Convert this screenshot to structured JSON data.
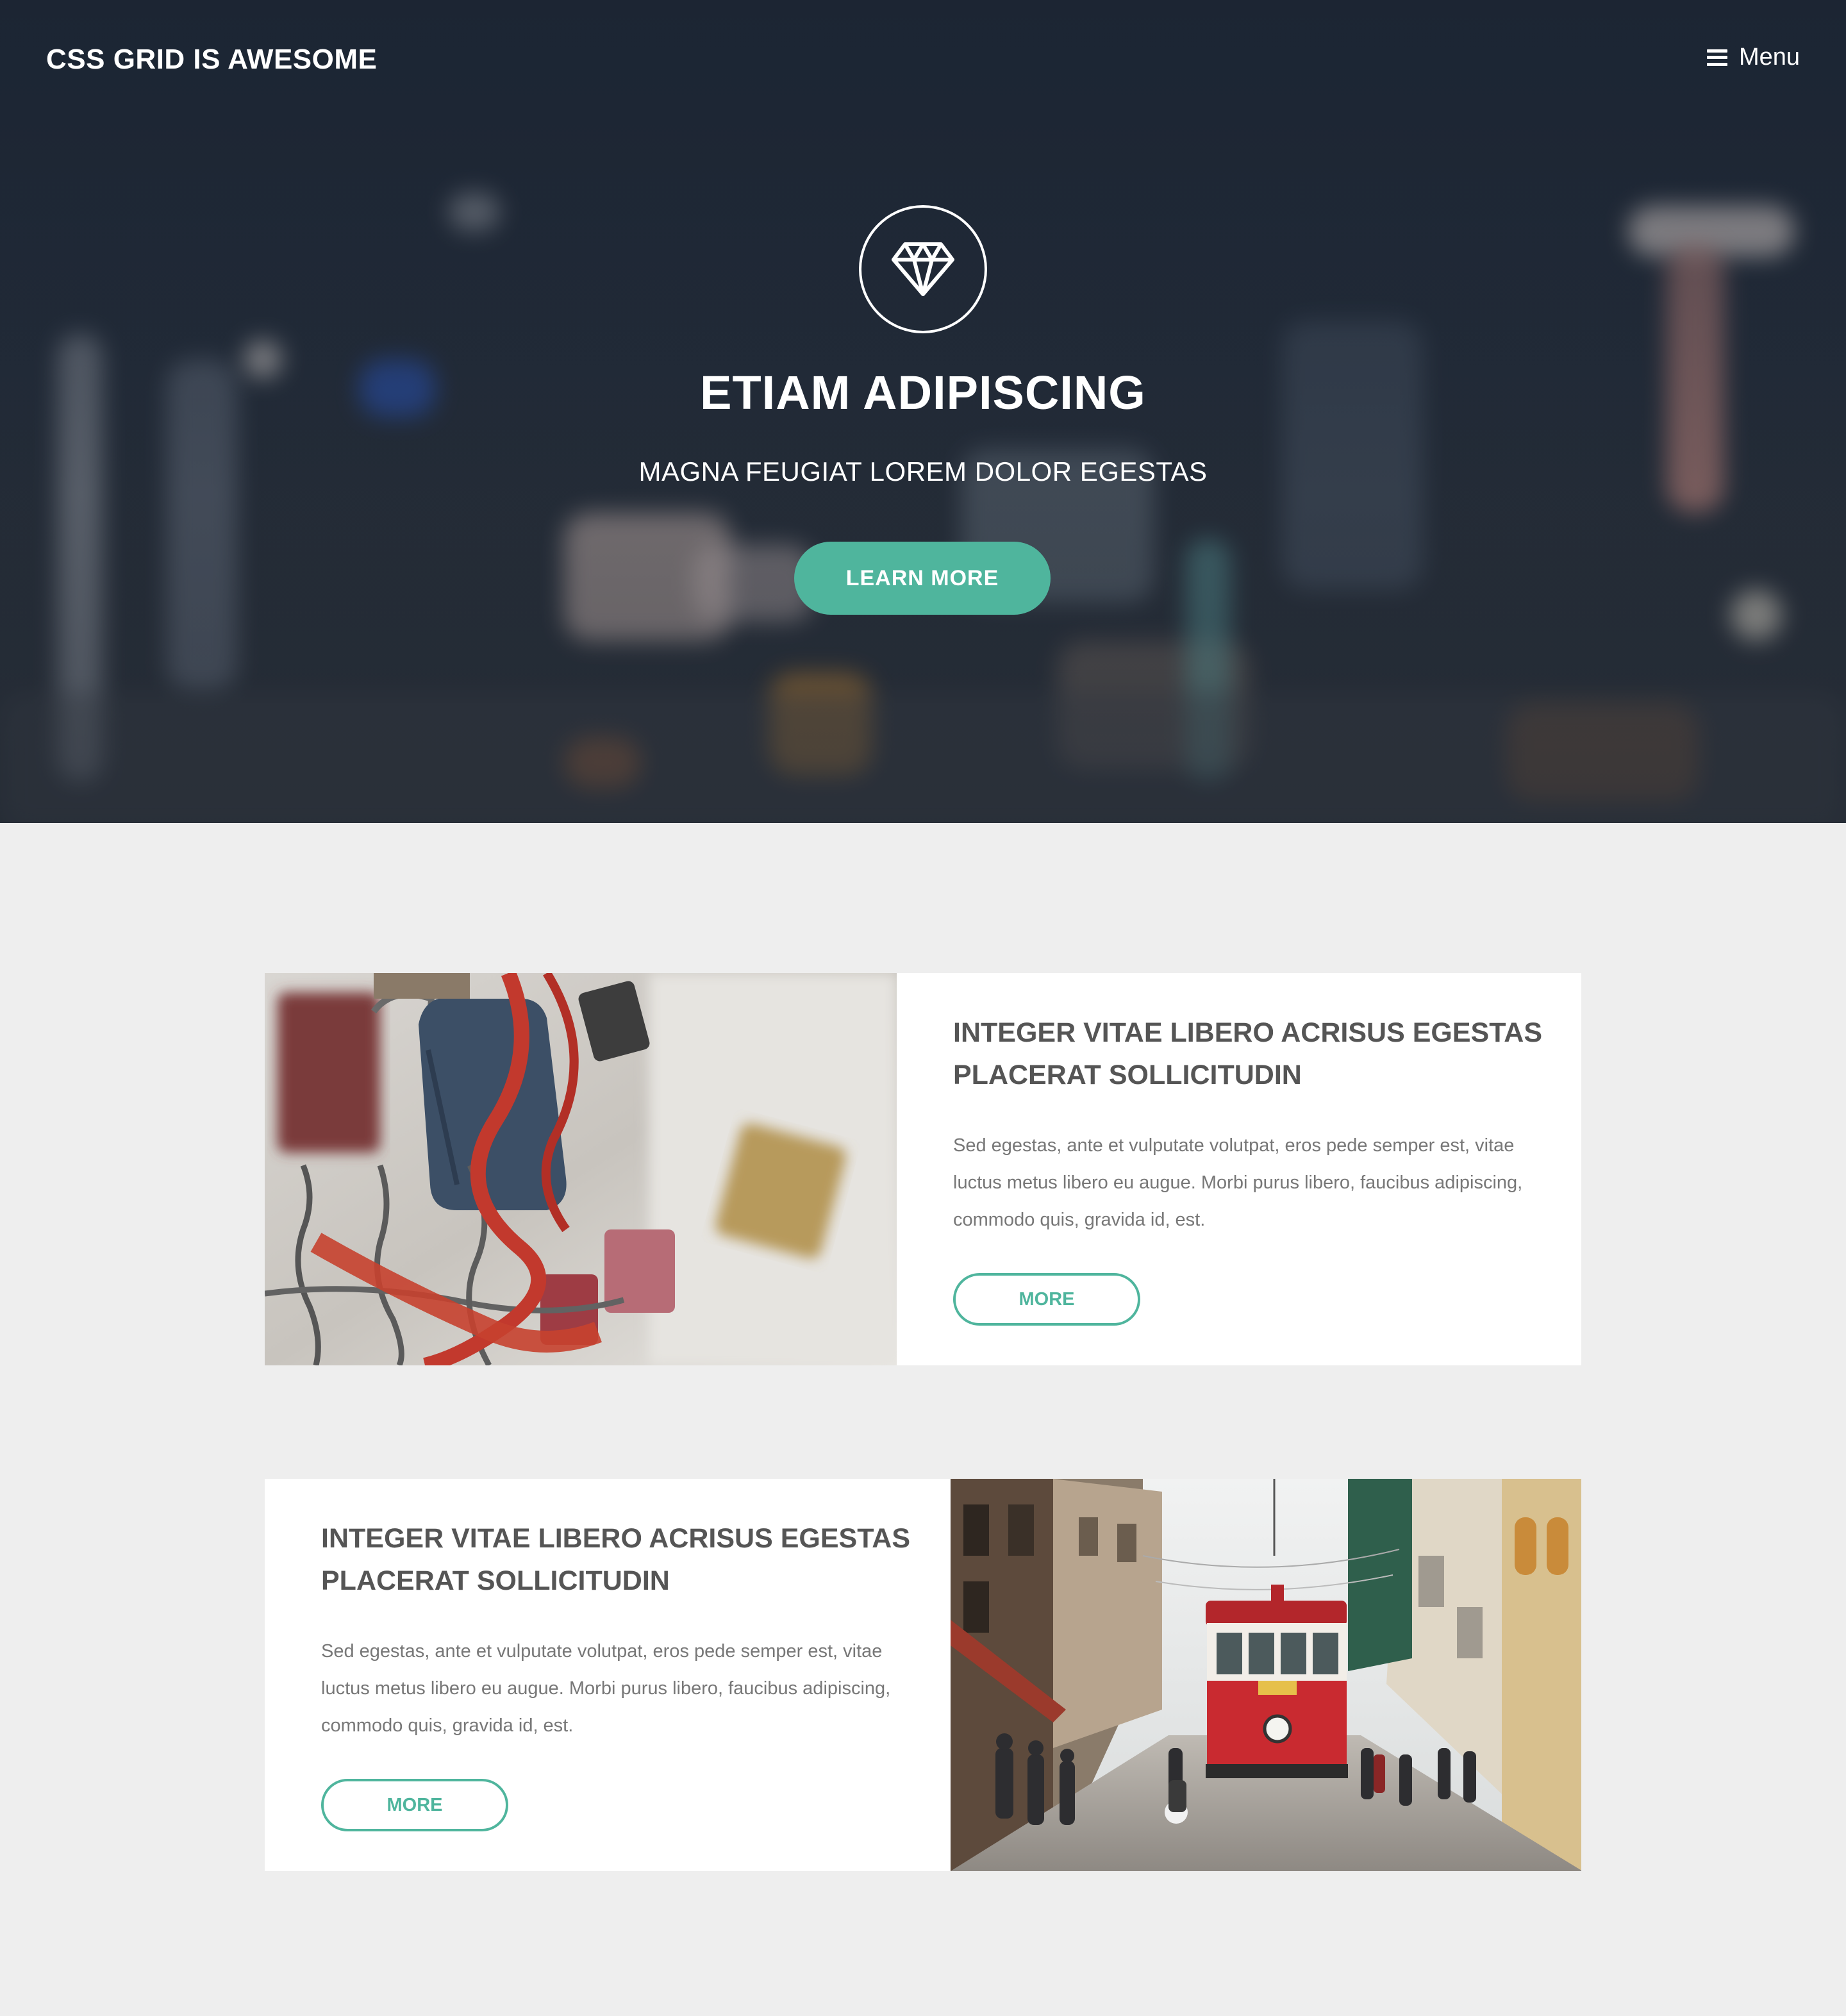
{
  "header": {
    "brand": "CSS GRID IS AWESOME",
    "menu_label": "Menu",
    "menu_icon": "hamburger-icon"
  },
  "hero": {
    "icon": "diamond-icon",
    "title": "ETIAM ADIPISCING",
    "subtitle": "MAGNA FEUGIAT LOREM DOLOR EGESTAS",
    "cta_label": "LEARN MORE"
  },
  "cards": [
    {
      "title": "INTEGER VITAE LIBERO ACRISUS EGESTAS PLACERAT SOLLICITUDIN",
      "body": "Sed egestas, ante et vulputate volutpat, eros pede semper est, vitae luctus metus libero eu augue. Morbi purus libero, faucibus adipiscing, commodo quis, gravida id, est.",
      "button": "MORE",
      "image": "padlocks-photo"
    },
    {
      "title": "INTEGER VITAE LIBERO ACRISUS EGESTAS PLACERAT SOLLICITUDIN",
      "body": "Sed egestas, ante et vulputate volutpat, eros pede semper est, vitae luctus metus libero eu augue. Morbi purus libero, faucibus adipiscing, commodo quis, gravida id, est.",
      "button": "MORE",
      "image": "tram-street-photo"
    }
  ],
  "colors": {
    "accent": "#4fb59d",
    "hero_bg": "#1c2533",
    "page_bg": "#eeeeee",
    "heading": "#555555",
    "body_text": "#777777"
  }
}
